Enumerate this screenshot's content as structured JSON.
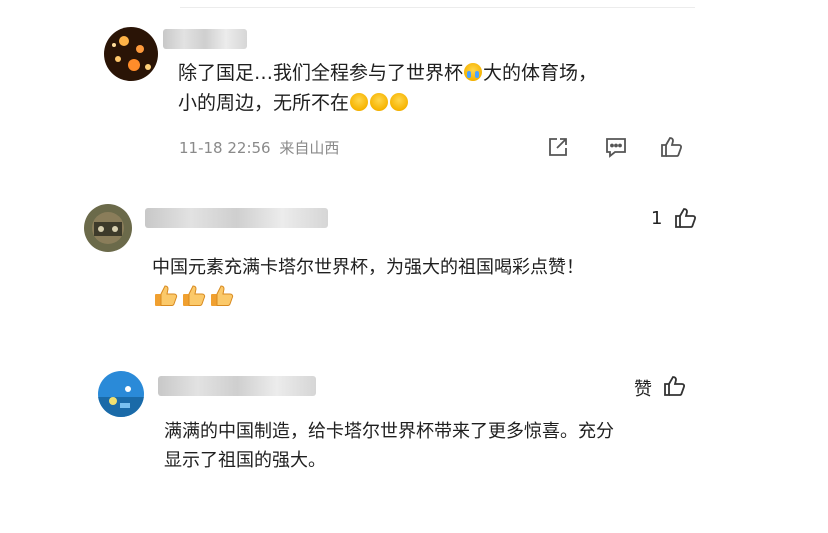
{
  "comments": [
    {
      "text_line1": "除了国足…我们全程参与了世界杯",
      "text_line1b": "大的体育场，",
      "text_line2": "小的周边，无所不在",
      "time": "11-18 22:56",
      "location": "来自山西"
    },
    {
      "likes": "1",
      "text": "中国元素充满卡塔尔世界杯，为强大的祖国喝彩点赞！"
    },
    {
      "like_label": "赞",
      "text_line1": "满满的中国制造，给卡塔尔世界杯带来了更多惊喜。充分",
      "text_line2": "显示了祖国的强大。"
    }
  ],
  "icons": [
    "share-icon",
    "reply-icon",
    "thumbs-up-icon"
  ]
}
